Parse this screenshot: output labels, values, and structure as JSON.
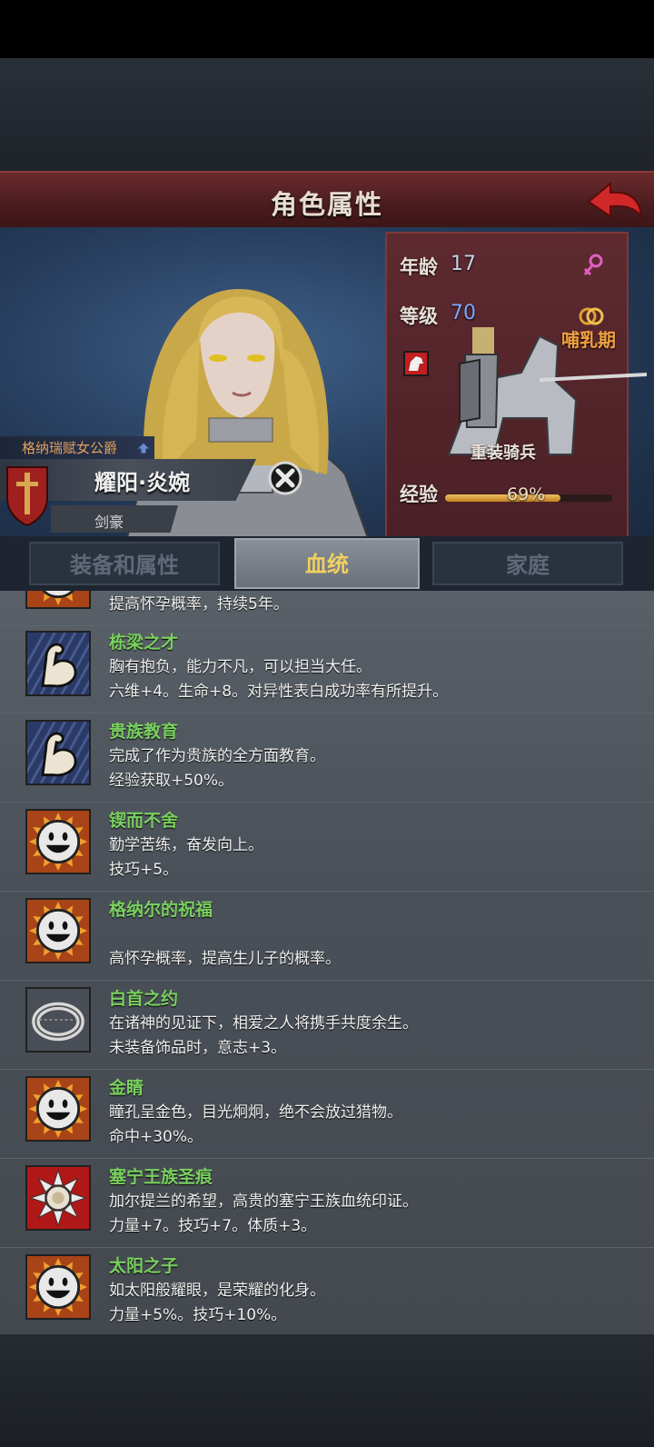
{
  "header": {
    "title": "角色属性"
  },
  "character": {
    "rank_title": "格纳瑞赋女公爵",
    "name": "耀阳·炎婉",
    "class": "剑豪"
  },
  "stats": {
    "age_label": "年龄",
    "age_value": "17",
    "level_label": "等级",
    "level_value": "70",
    "status": "哺乳期",
    "unit_type": "重装骑兵",
    "exp_label": "经验",
    "exp_value": "69%",
    "exp_fraction": 0.69
  },
  "tabs": [
    {
      "label": "装备和属性",
      "active": false
    },
    {
      "label": "血统",
      "active": true
    },
    {
      "label": "家庭",
      "active": false
    }
  ],
  "traits": [
    {
      "name": "",
      "desc": "提高怀孕概率，持续5年。",
      "effect": "",
      "icon": "sun-face-icon"
    },
    {
      "name": "栋梁之才",
      "desc": "胸有抱负，能力不凡，可以担当大任。",
      "effect": "六维+4。生命+8。对异性表白成功率有所提升。",
      "icon": "flexed-arm-icon"
    },
    {
      "name": "贵族教育",
      "desc": "完成了作为贵族的全方面教育。",
      "effect": "经验获取+50%。",
      "icon": "flexed-arm-icon"
    },
    {
      "name": "锲而不舍",
      "desc": "勤学苦练，奋发向上。",
      "effect": "技巧+5。",
      "icon": "sun-face-icon"
    },
    {
      "name": "格纳尔的祝福",
      "desc": "",
      "effect": "高怀孕概率，提高生儿子的概率。",
      "icon": "sun-face-icon"
    },
    {
      "name": "白首之约",
      "desc": "在诸神的见证下，相爱之人将携手共度余生。",
      "effect": "未装备饰品时，意志+3。",
      "icon": "ring-icon"
    },
    {
      "name": "金睛",
      "desc": "瞳孔呈金色，目光炯炯，绝不会放过猎物。",
      "effect": "命中+30%。",
      "icon": "sun-face-icon"
    },
    {
      "name": "塞宁王族圣痕",
      "desc": "加尔提兰的希望，高贵的塞宁王族血统印证。",
      "effect": "力量+7。技巧+7。体质+3。",
      "icon": "holy-sun-emblem-icon"
    },
    {
      "name": "太阳之子",
      "desc": "如太阳般耀眼，是荣耀的化身。",
      "effect": "力量+5%。技巧+10%。",
      "icon": "sun-face-icon"
    }
  ]
}
